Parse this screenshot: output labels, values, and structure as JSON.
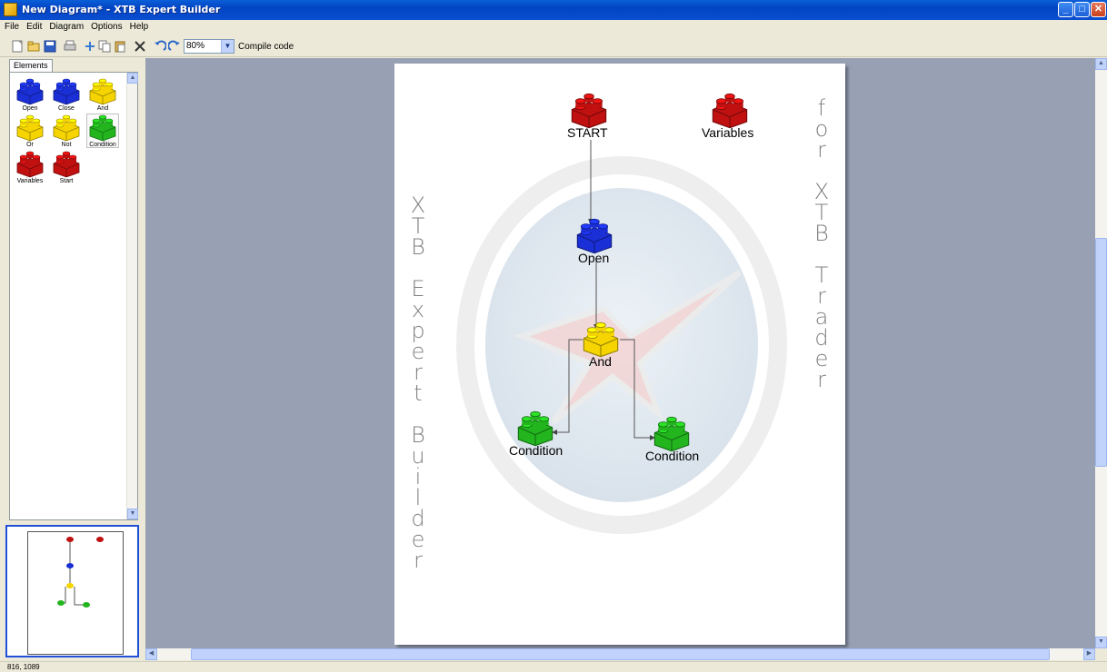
{
  "window": {
    "title": "New Diagram* - XTB Expert Builder",
    "min": "_",
    "max": "□",
    "close": "✕"
  },
  "menu": [
    "File",
    "Edit",
    "Diagram",
    "Options",
    "Help"
  ],
  "toolbar": {
    "icons": [
      "new-icon",
      "open-icon",
      "save-icon",
      "print-icon",
      "cut-icon",
      "copy-icon",
      "paste-icon",
      "delete-icon",
      "undo-icon",
      "redo-icon"
    ],
    "zoom": "80%",
    "compile_label": "Compile code"
  },
  "sidebar": {
    "tab_label": "Elements",
    "items": [
      {
        "label": "Open",
        "color": "#1a2fd6"
      },
      {
        "label": "Close",
        "color": "#1a2fd6"
      },
      {
        "label": "And",
        "color": "#f5d400"
      },
      {
        "label": "Or",
        "color": "#f5d400"
      },
      {
        "label": "Not",
        "color": "#f5d400"
      },
      {
        "label": "Condition",
        "color": "#22b51e"
      },
      {
        "label": "Variables",
        "color": "#c01010"
      },
      {
        "label": "Start",
        "color": "#c01010"
      }
    ]
  },
  "diagram": {
    "side_left": "XTB Expert Builder",
    "side_right": "for XTB Trader",
    "nodes": [
      {
        "label": "START",
        "color": "#c01010"
      },
      {
        "label": "Variables",
        "color": "#c01010"
      },
      {
        "label": "Open",
        "color": "#1a2fd6"
      },
      {
        "label": "And",
        "color": "#f5d400"
      },
      {
        "label": "Condition",
        "color": "#22b51e"
      },
      {
        "label": "Condition",
        "color": "#22b51e"
      }
    ]
  },
  "status": {
    "coords": "816, 1089"
  }
}
